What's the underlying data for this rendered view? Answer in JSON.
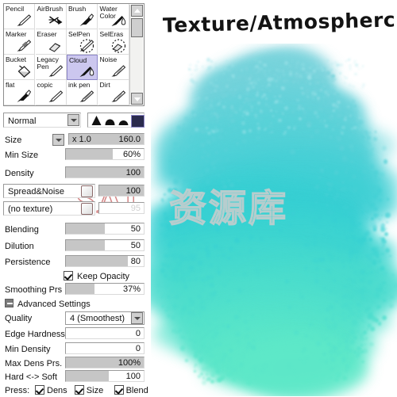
{
  "title": "Texture/Atmospherc",
  "watermark": {
    "latin": "SAI",
    "cjk": "资源库"
  },
  "brush_palette": {
    "tools": [
      {
        "label": "Pencil",
        "icon": "pencil-icon",
        "selected": false
      },
      {
        "label": "AirBrush",
        "icon": "airbrush-icon",
        "selected": false
      },
      {
        "label": "Brush",
        "icon": "brush-icon",
        "selected": false
      },
      {
        "label": "Water Color",
        "icon": "watercolor-icon",
        "selected": false
      },
      {
        "label": "Marker",
        "icon": "marker-icon",
        "selected": false
      },
      {
        "label": "Eraser",
        "icon": "eraser-icon",
        "selected": false
      },
      {
        "label": "SelPen",
        "icon": "selpen-icon",
        "selected": false
      },
      {
        "label": "SelEras",
        "icon": "seleras-icon",
        "selected": false
      },
      {
        "label": "Bucket",
        "icon": "bucket-icon",
        "selected": false
      },
      {
        "label": "Legacy Pen",
        "icon": "legacypen-icon",
        "selected": false
      },
      {
        "label": "Cloud",
        "icon": "cloud-brush-icon",
        "selected": true
      },
      {
        "label": "Noise",
        "icon": "noise-icon",
        "selected": false
      },
      {
        "label": "flat",
        "icon": "flat-icon",
        "selected": false
      },
      {
        "label": "copic",
        "icon": "copic-icon",
        "selected": false
      },
      {
        "label": "ink pen",
        "icon": "inkpen-icon",
        "selected": false
      },
      {
        "label": "Dirt",
        "icon": "dirt-icon",
        "selected": false
      }
    ]
  },
  "blend_mode": {
    "value": "Normal"
  },
  "brush_shapes": {
    "selected_index": 3,
    "count": 4
  },
  "settings": {
    "size": {
      "label": "Size",
      "multiplier": "x 1.0",
      "value": "160.0"
    },
    "min_size": {
      "label": "Min Size",
      "value": "60%",
      "fill_percent": 60
    },
    "density": {
      "label": "Density",
      "value": "100",
      "fill_percent": 100
    },
    "spread_noise": {
      "label": "Spread&Noise",
      "value": "100",
      "fill_percent": 100
    },
    "texture": {
      "label": "(no texture)",
      "value": "95",
      "fill_percent": 0,
      "disabled": true
    },
    "blending": {
      "label": "Blending",
      "value": "50",
      "fill_percent": 50
    },
    "dilution": {
      "label": "Dilution",
      "value": "50",
      "fill_percent": 50
    },
    "persistence": {
      "label": "Persistence",
      "value": "80",
      "fill_percent": 80
    },
    "keep_opacity": {
      "label": "Keep Opacity",
      "checked": true
    },
    "smoothing_prs": {
      "label": "Smoothing Prs",
      "value": "37%",
      "fill_percent": 37
    }
  },
  "advanced": {
    "header": "Advanced Settings",
    "expanded": true,
    "quality": {
      "label": "Quality",
      "value": "4 (Smoothest)"
    },
    "edge_hardness": {
      "label": "Edge Hardness",
      "value": "0",
      "fill_percent": 0
    },
    "min_density": {
      "label": "Min Density",
      "value": "0",
      "fill_percent": 0
    },
    "max_dens_prs": {
      "label": "Max Dens Prs.",
      "value": "100%",
      "fill_percent": 100
    },
    "hard_soft": {
      "label": "Hard <-> Soft",
      "value": "100",
      "fill_percent": 55
    },
    "press": {
      "label": "Press:",
      "options": [
        {
          "label": "Dens",
          "checked": true
        },
        {
          "label": "Size",
          "checked": true
        },
        {
          "label": "Blend",
          "checked": true
        }
      ]
    }
  },
  "artwork": {
    "colors": {
      "top": "#7fd4dd",
      "mid": "#35cfd3",
      "bottom": "#5ee8c8",
      "edge": "#9fe4ea"
    }
  }
}
